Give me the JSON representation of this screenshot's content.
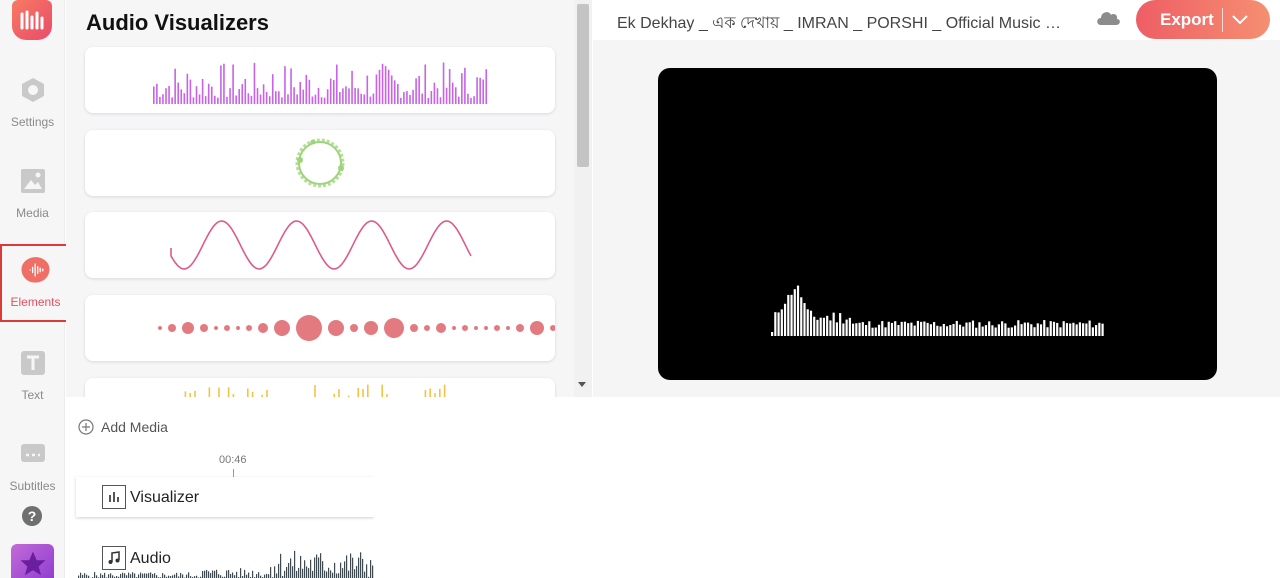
{
  "sidebar": {
    "items": [
      {
        "label": "Settings",
        "icon": "gear-icon"
      },
      {
        "label": "Media",
        "icon": "image-icon"
      },
      {
        "label": "Elements",
        "icon": "waveform-icon",
        "active": true
      },
      {
        "label": "Text",
        "icon": "text-icon"
      },
      {
        "label": "Subtitles",
        "icon": "subtitles-icon"
      }
    ],
    "help_label": "?"
  },
  "panel": {
    "title": "Audio Visualizers",
    "visualizers": [
      {
        "style": "bars",
        "color": "#c862e8"
      },
      {
        "style": "circle",
        "color": "#9ed47a"
      },
      {
        "style": "wave",
        "color": "#dc5b8b"
      },
      {
        "style": "dots",
        "color": "#e37a7f"
      },
      {
        "style": "bars",
        "color": "#f3c246"
      }
    ]
  },
  "header": {
    "file_title": "Ek Dekhay _ এক দেখায় _ IMRAN _ PORSHI _ Official Music Video",
    "export_label": "Export"
  },
  "timeline": {
    "add_media_label": "Add Media",
    "timecode": "00:46",
    "tracks": [
      {
        "label": "Visualizer",
        "icon": "bar-chart-icon"
      },
      {
        "label": "Audio",
        "icon": "music-note-icon"
      }
    ]
  },
  "colors": {
    "accent": "#e5505e",
    "export_gradient_start": "#ee5e65",
    "export_gradient_end": "#f58f71"
  }
}
